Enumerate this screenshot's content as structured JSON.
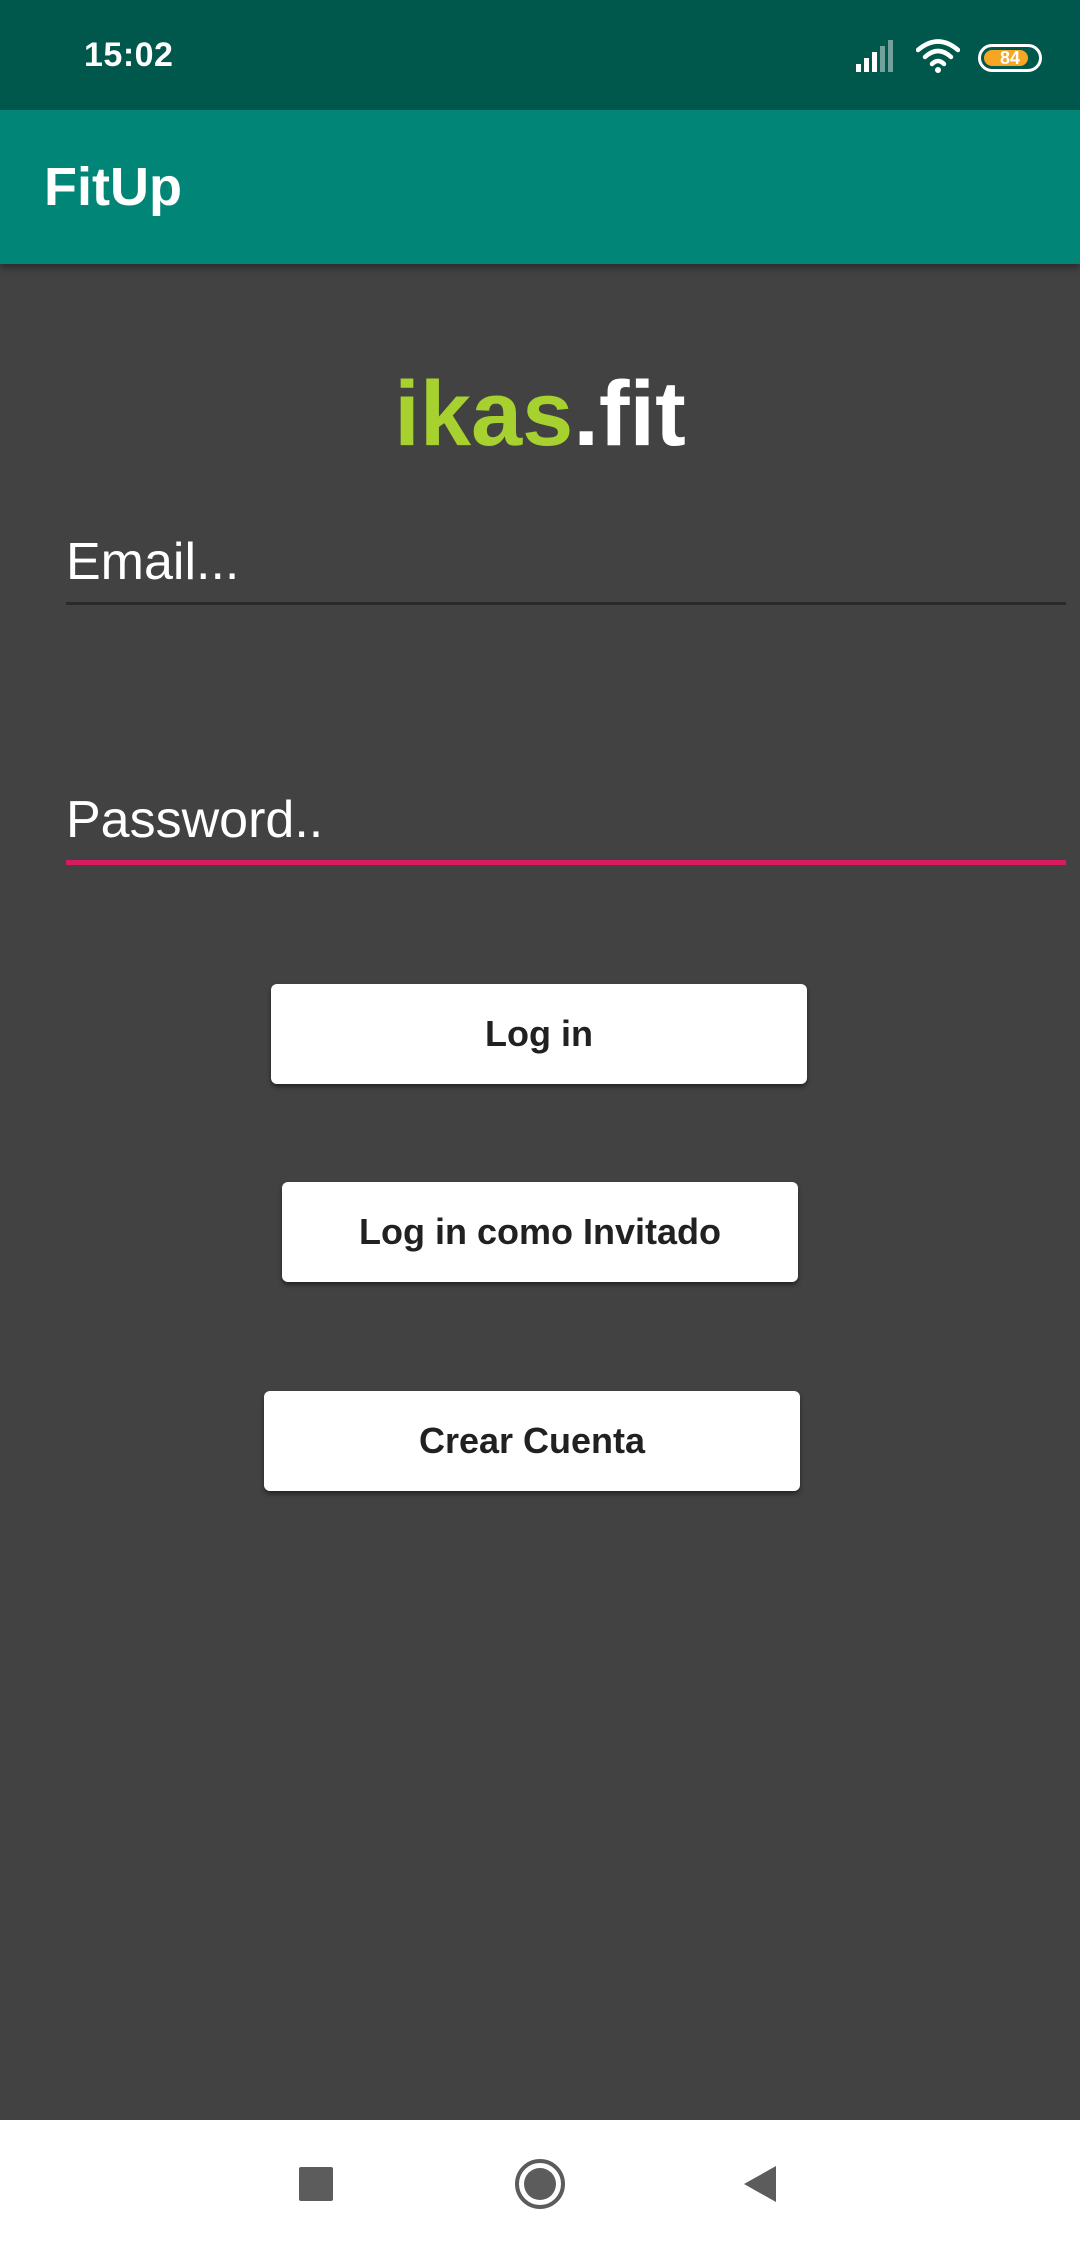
{
  "status_bar": {
    "time": "15:02",
    "battery_level": "84",
    "battery_fraction": 0.84,
    "icons": [
      "signal-icon",
      "wifi-icon",
      "battery-icon"
    ]
  },
  "app_bar": {
    "title": "FitUp",
    "color": "#008577"
  },
  "logo": {
    "part1": "ikas",
    "part2": ".fit",
    "part1_color": "#A6D12F"
  },
  "form": {
    "email_placeholder": "Email...",
    "email_value": "",
    "password_placeholder": "Password..",
    "password_value": "",
    "focused_field_accent": "#D81B60"
  },
  "buttons": {
    "login": "Log in",
    "guest": "Log in como Invitado",
    "create": "Crear Cuenta"
  },
  "nav_bar": {
    "items": [
      "recents-square-icon",
      "home-circle-icon",
      "back-triangle-icon"
    ]
  }
}
